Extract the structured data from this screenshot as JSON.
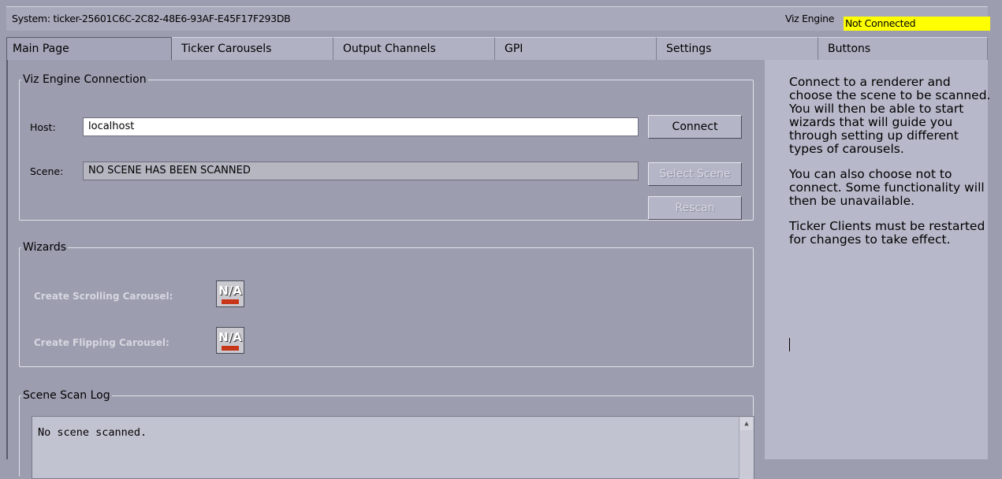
{
  "titlebar": {
    "system_text": "System: ticker-25601C6C-2C82-48E6-93AF-E45F17F293DB",
    "engine_label": "Viz Engine",
    "engine_status": "Not Connected",
    "status_color": "#ffff00"
  },
  "tabs": [
    {
      "label": "Main Page"
    },
    {
      "label": "Ticker Carousels"
    },
    {
      "label": "Output Channels"
    },
    {
      "label": "GPI"
    },
    {
      "label": "Settings"
    },
    {
      "label": "Buttons"
    }
  ],
  "connection": {
    "legend": "Viz Engine Connection",
    "host_label": "Host:",
    "host_value": "localhost",
    "scene_label": "Scene:",
    "scene_value": "NO SCENE HAS BEEN SCANNED",
    "connect_button": "Connect",
    "select_scene_button": "Select Scene",
    "rescan_button": "Rescan"
  },
  "wizards": {
    "legend": "Wizards",
    "scrolling_label": "Create Scrolling Carousel:",
    "flipping_label": "Create Flipping Carousel:",
    "icon_text": "N/A",
    "scrolling_icon": "scrolling-carousel-icon",
    "flipping_icon": "flipping-carousel-icon"
  },
  "log": {
    "legend": "Scene Scan Log",
    "text": "No scene scanned."
  },
  "help": {
    "p1": "Connect to a renderer and choose the scene to be scanned. You will then be able to start wizards that will guide you through setting up different types of carousels.",
    "p2": "You can also choose not to connect. Some functionality will then be unavailable.",
    "p3": "Ticker Clients must be restarted for changes to take effect."
  }
}
